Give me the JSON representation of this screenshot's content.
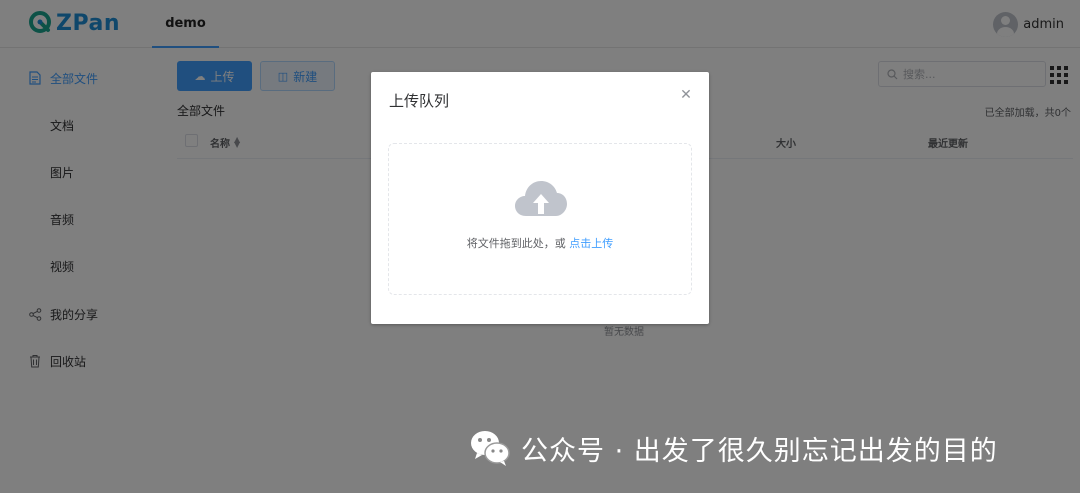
{
  "app": {
    "logo_text": "ZPan",
    "top_tab": "demo",
    "user_name": "admin"
  },
  "sidebar": {
    "items": [
      {
        "label": "全部文件",
        "icon": "document-icon",
        "active": true
      },
      {
        "label": "文档",
        "icon": "",
        "active": false
      },
      {
        "label": "图片",
        "icon": "",
        "active": false
      },
      {
        "label": "音频",
        "icon": "",
        "active": false
      },
      {
        "label": "视频",
        "icon": "",
        "active": false
      },
      {
        "label": "我的分享",
        "icon": "share-icon",
        "active": false
      },
      {
        "label": "回收站",
        "icon": "trash-icon",
        "active": false
      }
    ]
  },
  "toolbar": {
    "upload_label": "上传",
    "new_label": "新建",
    "search_placeholder": "搜索..."
  },
  "main": {
    "breadcrumb": "全部文件",
    "summary": "已全部加载，共0个",
    "columns": {
      "name": "名称",
      "size": "大小",
      "updated": "最近更新"
    },
    "empty_text": "暂无数据"
  },
  "dialog": {
    "title": "上传队列",
    "close_icon": "close-icon",
    "drop_text": "将文件拖到此处，或 ",
    "drop_link": "点击上传"
  },
  "watermark": {
    "text": "公众号 · 出发了很久别忘记出发的目的"
  },
  "colors": {
    "accent": "#409eff",
    "brand": "#1f8fd6"
  }
}
